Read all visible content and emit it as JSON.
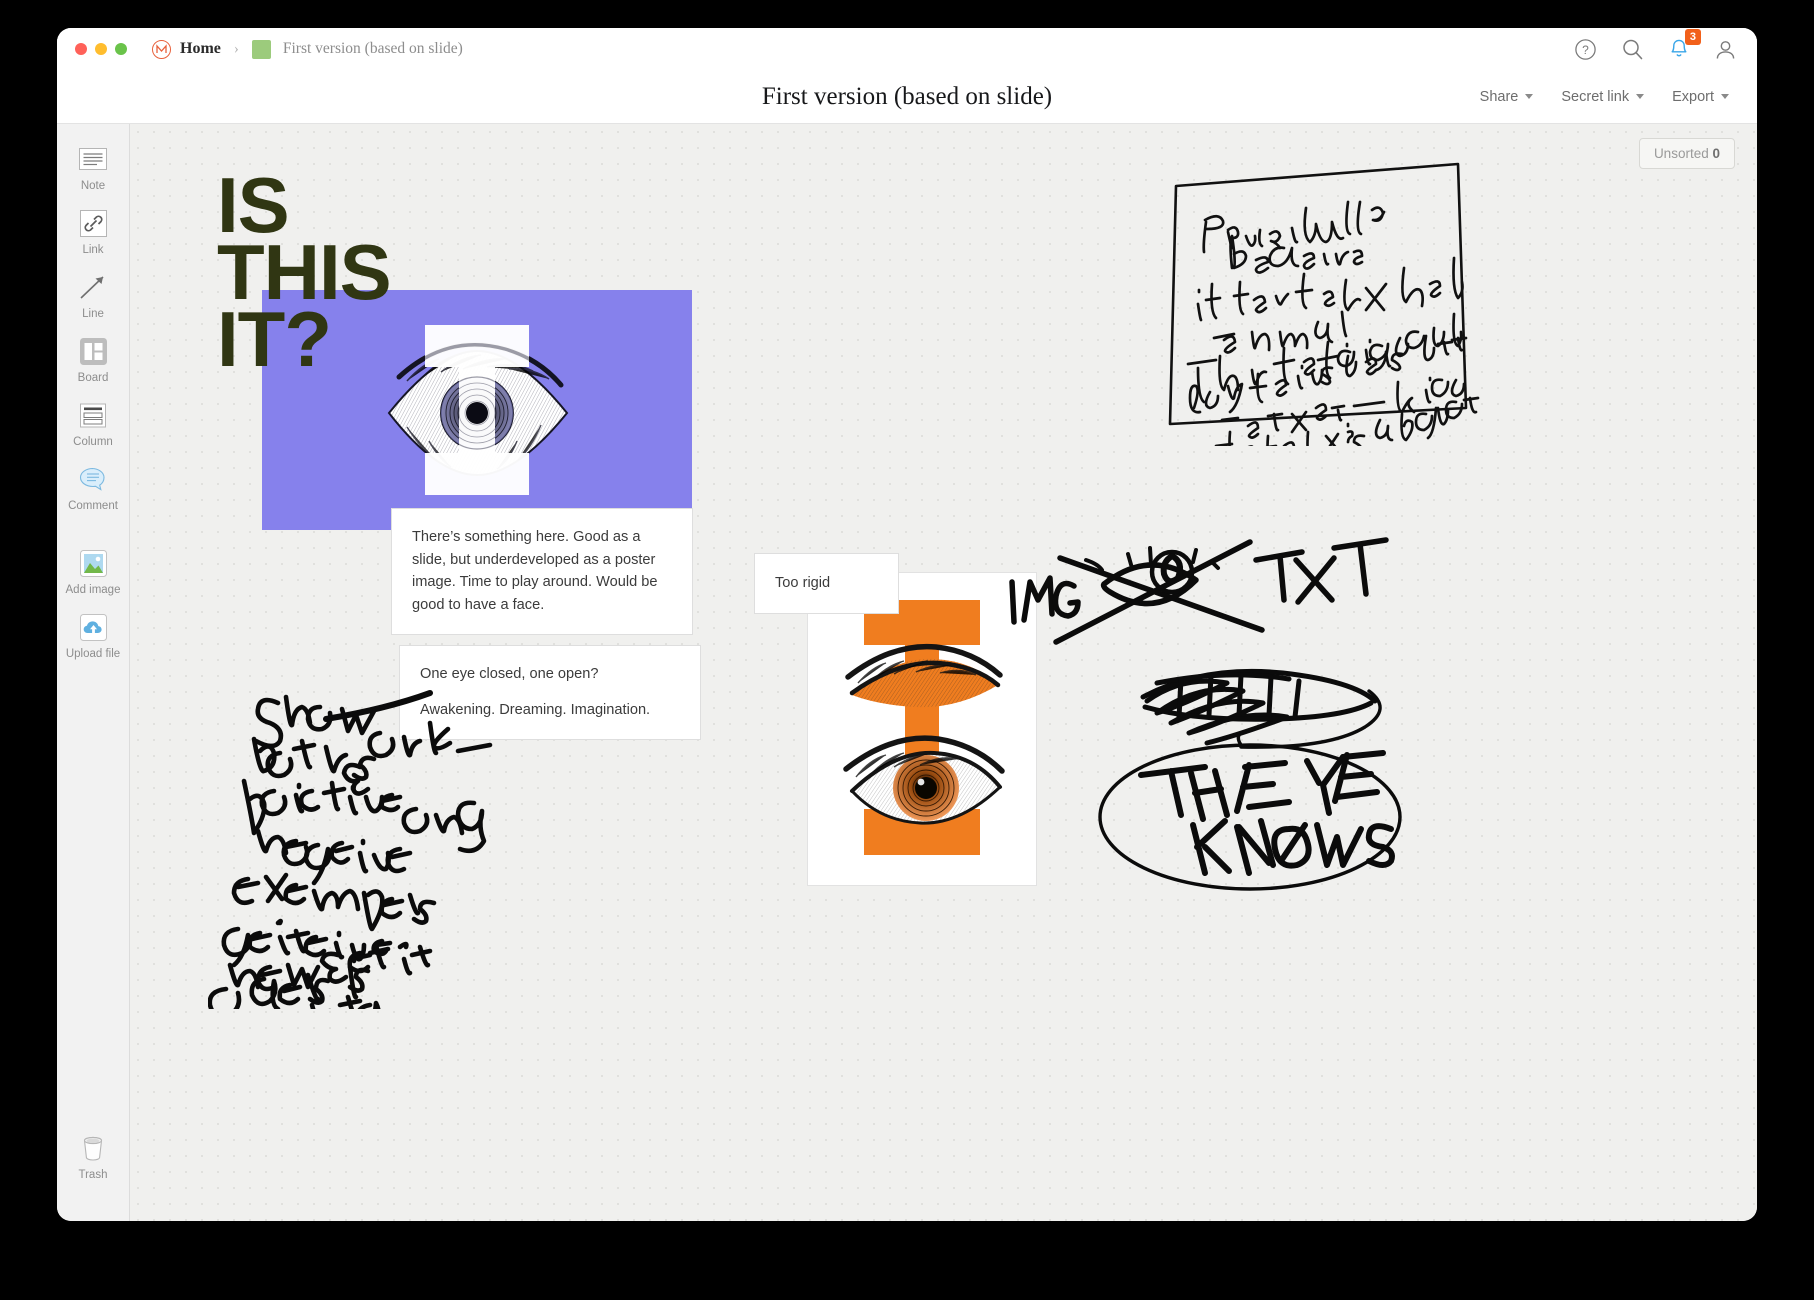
{
  "window": {
    "traffic_lights": [
      "close",
      "minimize",
      "maximize"
    ],
    "brand_icon": "milanote-logo-icon",
    "breadcrumb": {
      "home_label": "Home",
      "separator": "›",
      "swatch_color": "#9ccb7c",
      "current_label": "First version (based on slide)"
    },
    "right_icons": [
      {
        "name": "help-icon",
        "glyph": "?"
      },
      {
        "name": "search-icon",
        "glyph": "search"
      },
      {
        "name": "notifications-bell-icon",
        "glyph": "bell",
        "badge": "3",
        "badge_color": "#f2601a"
      },
      {
        "name": "user-avatar-icon",
        "glyph": "person"
      }
    ]
  },
  "doc_header": {
    "title": "First version (based on slide)",
    "actions": [
      {
        "name": "share",
        "label": "Share"
      },
      {
        "name": "secret-link",
        "label": "Secret link"
      },
      {
        "name": "export",
        "label": "Export"
      }
    ]
  },
  "sidebar": {
    "tools": [
      {
        "name": "note",
        "label": "Note",
        "icon": "note-lines-icon",
        "active": false
      },
      {
        "name": "link",
        "label": "Link",
        "icon": "chain-link-icon",
        "active": false
      },
      {
        "name": "line",
        "label": "Line",
        "icon": "diagonal-arrow-icon",
        "active": false
      },
      {
        "name": "board",
        "label": "Board",
        "icon": "board-panels-icon",
        "active": true
      },
      {
        "name": "column",
        "label": "Column",
        "icon": "column-stack-icon",
        "active": false
      },
      {
        "name": "comment",
        "label": "Comment",
        "icon": "speech-bubble-icon",
        "active": false
      },
      {
        "name": "add-image",
        "label": "Add image",
        "icon": "picture-icon",
        "active": false
      },
      {
        "name": "upload-file",
        "label": "Upload file",
        "icon": "cloud-upload-icon",
        "active": false
      }
    ],
    "trash": {
      "label": "Trash",
      "icon": "trash-bin-icon"
    }
  },
  "canvas": {
    "unsorted_label": "Unsorted",
    "unsorted_count": "0",
    "headline": "IS\nTHIS\nIT?",
    "headline_color": "#303613",
    "purple_poster": {
      "name": "purple-poster-card",
      "background_color": "#8681ec",
      "letterform": "I",
      "letterform_color": "#ffffff",
      "artwork": "engraved-open-eye"
    },
    "orange_poster": {
      "name": "orange-poster-card",
      "background_color": "#ffffff",
      "letterform": "I",
      "letterform_color": "#f07d1f",
      "artwork": "engraved-two-eyes-one-closed-one-open"
    },
    "notes": [
      {
        "name": "note-there-is-something-here",
        "lines": [
          "There’s something here. Good as a slide, but underdeveloped as a poster image. Time to play around. Would be good to have a face."
        ]
      },
      {
        "name": "note-one-eye-closed",
        "lines": [
          "One eye closed, one open?",
          "Awakening. Dreaming. Imagination."
        ]
      },
      {
        "name": "note-too-rigid",
        "lines": [
          "Too rigid"
        ]
      }
    ],
    "ink_annotations": [
      {
        "name": "handwritten-memo-poster-would-be-easier",
        "transcript": "Poster would be easier if the talk had a name! Then the design could play the visuals off the text — like the talk's subject."
      },
      {
        "name": "handwritten-img-txt-eye-crossout",
        "transcript": "IMG × TXT"
      },
      {
        "name": "handwritten-the-eye-knows",
        "transcript": "THE EYE KNOWS"
      },
      {
        "name": "handwritten-show-work",
        "transcript": "Show work — both as positive and negative examples against a new set of goals I've created for myself"
      }
    ]
  }
}
